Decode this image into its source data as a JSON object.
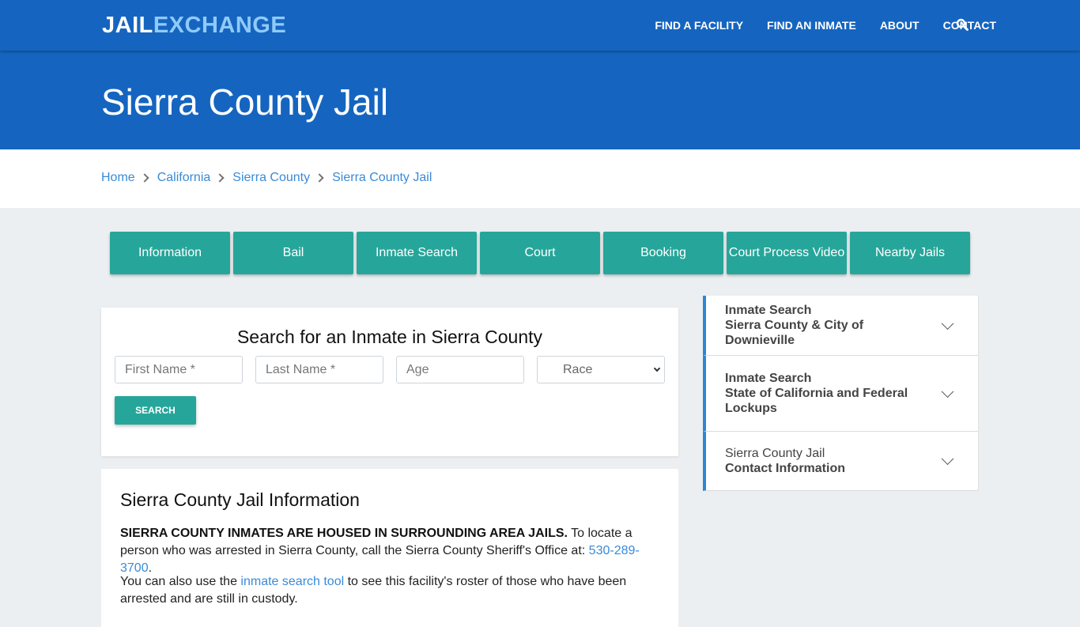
{
  "header": {
    "logo_part1": "JAIL",
    "logo_part2": "EXCHANGE",
    "nav": [
      "FIND A FACILITY",
      "FIND AN INMATE",
      "ABOUT",
      "CONTACT"
    ],
    "search_icon": "search-icon"
  },
  "hero": {
    "title": "Sierra County Jail"
  },
  "breadcrumb": [
    "Home",
    "California",
    "Sierra County",
    "Sierra County Jail"
  ],
  "tabs": [
    "Information",
    "Bail",
    "Inmate Search",
    "Court",
    "Booking",
    "Court Process Video",
    "Nearby Jails"
  ],
  "search": {
    "title": "Search for an Inmate in Sierra County",
    "first_name_placeholder": "First Name *",
    "last_name_placeholder": "Last Name *",
    "age_placeholder": "Age",
    "race_selected": "Race",
    "button": "SEARCH"
  },
  "info": {
    "title": "Sierra County Jail Information",
    "p1_bold": "SIERRA COUNTY INMATES ARE HOUSED IN SURROUNDING AREA JAILS.",
    "p1_text": " To locate a person who was arrested in Sierra County, call the Sierra County Sheriff's Office at: ",
    "p1_phone": "530-289-3700",
    "p1_end": ".",
    "p2_start": "You can also use the ",
    "p2_link": "inmate search tool",
    "p2_end": " to see this facility's roster of those who have been arrested and are still in custody."
  },
  "sidebar": [
    {
      "line1": "Inmate Search",
      "line2": "Sierra County & City of Downieville"
    },
    {
      "line1": "Inmate Search",
      "line2": "State of California and Federal Lockups"
    },
    {
      "line1": "Sierra County Jail",
      "line2": "Contact Information"
    }
  ],
  "colors": {
    "brand_blue": "#1565c0",
    "logo_accent": "#90caf9",
    "teal": "#26a69a",
    "link": "#3a8ad8"
  }
}
